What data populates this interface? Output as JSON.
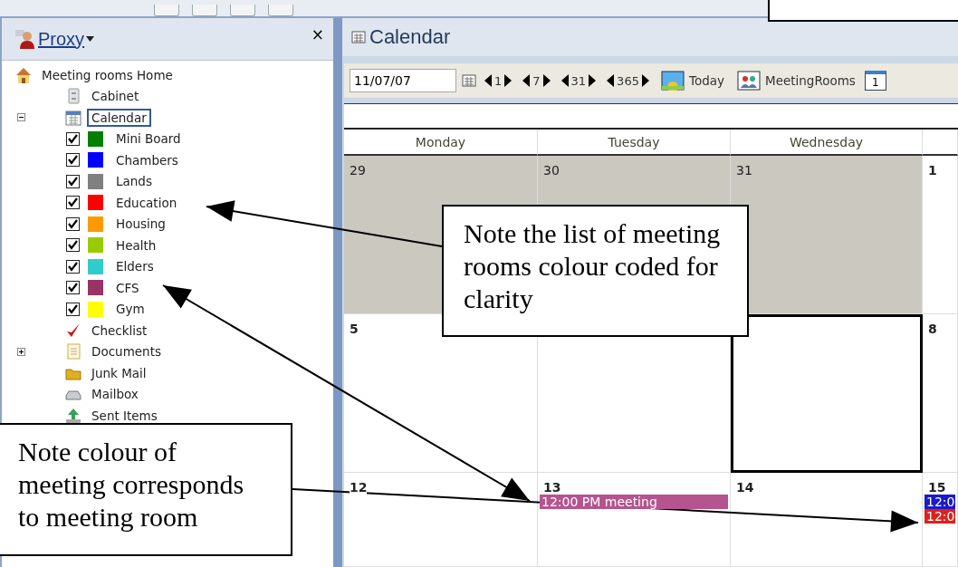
{
  "sidebar": {
    "title": "Proxy",
    "close": "×",
    "tree": [
      {
        "label": "Meeting rooms Home",
        "kind": "folder",
        "children": [
          {
            "label": "Cabinet",
            "kind": "folder",
            "selected": false
          },
          {
            "label": "Calendar",
            "kind": "folder",
            "selected": true,
            "expanded": true,
            "children": [
              {
                "label": "Mini Board",
                "kind": "room",
                "checked": true,
                "color": "#008000"
              },
              {
                "label": "Chambers",
                "kind": "room",
                "checked": true,
                "color": "#0000ff"
              },
              {
                "label": "Lands",
                "kind": "room",
                "checked": true,
                "color": "#808080"
              },
              {
                "label": "Education",
                "kind": "room",
                "checked": true,
                "color": "#ff0000"
              },
              {
                "label": "Housing",
                "kind": "room",
                "checked": true,
                "color": "#ff9900"
              },
              {
                "label": "Health",
                "kind": "room",
                "checked": true,
                "color": "#99cc00"
              },
              {
                "label": "Elders",
                "kind": "room",
                "checked": true,
                "color": "#33cccc"
              },
              {
                "label": "CFS",
                "kind": "room",
                "checked": true,
                "color": "#993366"
              },
              {
                "label": "Gym",
                "kind": "room",
                "checked": true,
                "color": "#ffff00"
              }
            ]
          },
          {
            "label": "Checklist",
            "kind": "folder",
            "selected": false
          },
          {
            "label": "Documents",
            "kind": "folder",
            "selected": false,
            "expanded": false
          },
          {
            "label": "Junk Mail",
            "kind": "folder",
            "selected": false
          },
          {
            "label": "Mailbox",
            "kind": "folder",
            "selected": false
          },
          {
            "label": "Sent Items",
            "kind": "folder",
            "selected": false
          }
        ]
      }
    ]
  },
  "calendar": {
    "title": "Calendar",
    "date": "11/07/07",
    "steps": [
      "1",
      "7",
      "31",
      "365"
    ],
    "buttons": [
      "Today",
      "MeetingRooms"
    ],
    "view_number": "1",
    "columns": [
      "Monday",
      "Tuesday",
      "Wednesday",
      null
    ],
    "weeks": [
      [
        {
          "day": "29",
          "outside": true,
          "selected": false
        },
        {
          "day": "30",
          "outside": true,
          "selected": false
        },
        {
          "day": "31",
          "outside": true,
          "selected": false
        },
        {
          "day": "1",
          "outside": false,
          "selected": false
        }
      ],
      [
        {
          "day": "5",
          "outside": false,
          "selected": false
        },
        {
          "outside": false,
          "selected": false
        },
        {
          "outside": false,
          "selected": true
        },
        {
          "day": "8",
          "outside": false,
          "selected": false
        }
      ],
      [
        {
          "day": "12",
          "outside": false,
          "selected": false
        },
        {
          "day": "13",
          "outside": false,
          "selected": false,
          "events": [
            {
              "text": "12:00 PM  meeting",
              "color": "#b5548f"
            }
          ]
        },
        {
          "day": "14",
          "outside": false,
          "selected": false
        },
        {
          "day": "15",
          "outside": false,
          "selected": false,
          "events": [
            {
              "text": "12:0",
              "color": "#1a1acc"
            },
            {
              "text": "12:0",
              "color": "#e0201c"
            }
          ]
        }
      ]
    ]
  },
  "annotations": [
    {
      "text": "Note the list of meeting rooms colour coded for clarity"
    },
    {
      "text": "Note colour of meeting corresponds to meeting room"
    }
  ]
}
